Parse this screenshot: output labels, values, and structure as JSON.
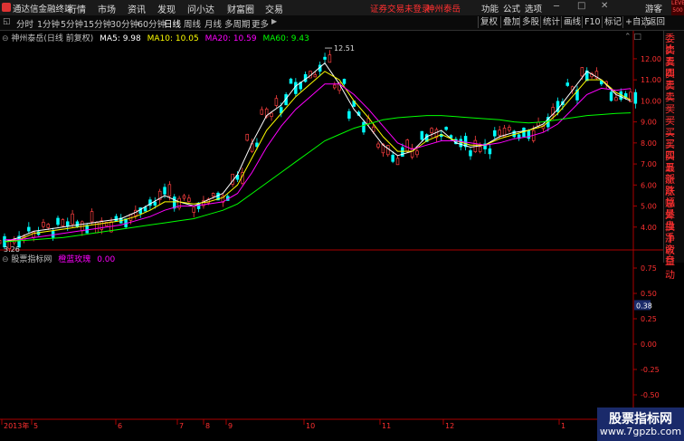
{
  "top": {
    "app_title": "通达信金融终端",
    "menu": [
      "行情",
      "市场",
      "资讯",
      "发现",
      "问小达",
      "财富圈",
      "交易"
    ],
    "login_notice": "证券交易未登录",
    "stock_name": "神州泰岳",
    "right_menu": [
      "功能",
      "公式",
      "选项"
    ],
    "guest": "游客",
    "level_badge": "LEVEL 500"
  },
  "toolbar": {
    "periods": [
      "分时",
      "1分钟",
      "5分钟",
      "15分钟",
      "30分钟",
      "60分钟",
      "日线",
      "周线",
      "月线",
      "多周期",
      "更多"
    ],
    "active_period": "日线",
    "buttons": [
      "复权",
      "叠加",
      "多股",
      "统计",
      "画线",
      "F10",
      "标记",
      "+自选",
      "返回"
    ]
  },
  "main_chart": {
    "title": "神州泰岳(日线 前复权)",
    "ma": [
      {
        "label": "MA5: 9.98",
        "color": "#ffffff"
      },
      {
        "label": "MA10: 10.05",
        "color": "#ffff00"
      },
      {
        "label": "MA20: 10.59",
        "color": "#ff00ff"
      },
      {
        "label": "MA60: 9.43",
        "color": "#00ff00"
      }
    ],
    "high_label": "12.51",
    "low_label": "3.26",
    "y_ticks": [
      "12.00",
      "11.00",
      "10.00",
      "9.00",
      "8.00",
      "7.00",
      "6.00",
      "5.00",
      "4.00"
    ]
  },
  "side_panel": {
    "items": [
      "委比",
      "卖五",
      "卖四",
      "卖三",
      "卖二",
      "卖一",
      "买一",
      "买二",
      "买三",
      "买四",
      "买五",
      "最新",
      "涨跌",
      "涨幅",
      "总量",
      "外盘",
      "换手",
      "净资",
      "收益"
    ],
    "auto": "自动"
  },
  "sub_chart": {
    "source": "股票指标网",
    "indicator": "橙蓝玫瑰",
    "value": "0.00",
    "y_ticks": [
      "0.75",
      "0.50",
      "0.25",
      "0.00",
      "-0.25",
      "-0.50",
      "-0.75"
    ],
    "marker": "0.38"
  },
  "x_axis": {
    "labels": [
      "2013年",
      "5",
      "6",
      "7",
      "8",
      "9",
      "10",
      "11",
      "12",
      "1",
      "2"
    ]
  },
  "watermark": {
    "line1": "股票指标网",
    "line2": "www.7gpzb.com"
  },
  "chart_data": {
    "type": "candlestick",
    "yscale": "price",
    "ylim": [
      3.0,
      12.9
    ],
    "series": [
      {
        "name": "MA5",
        "color": "#ffffff",
        "values": [
          3.3,
          3.5,
          3.8,
          3.9,
          4.0,
          4.1,
          4.2,
          4.3,
          4.4,
          4.7,
          5.1,
          5.5,
          5.2,
          5.0,
          5.3,
          5.6,
          6.5,
          8.0,
          9.3,
          9.8,
          10.7,
          11.2,
          11.8,
          10.8,
          9.6,
          8.8,
          7.9,
          7.4,
          7.6,
          8.3,
          8.6,
          8.0,
          7.8,
          7.9,
          8.3,
          8.5,
          8.6,
          8.9,
          9.6,
          10.5,
          11.4,
          11.0,
          10.3,
          10.0
        ]
      },
      {
        "name": "MA10",
        "color": "#ffff00",
        "values": [
          3.3,
          3.4,
          3.7,
          3.8,
          3.9,
          4.0,
          4.1,
          4.2,
          4.3,
          4.5,
          4.8,
          5.2,
          5.2,
          5.1,
          5.2,
          5.4,
          6.0,
          7.3,
          8.6,
          9.4,
          10.2,
          10.8,
          11.4,
          11.0,
          10.0,
          9.2,
          8.3,
          7.6,
          7.6,
          8.1,
          8.4,
          8.1,
          7.9,
          7.9,
          8.2,
          8.4,
          8.6,
          8.8,
          9.4,
          10.2,
          11.0,
          11.0,
          10.4,
          10.05
        ]
      },
      {
        "name": "MA20",
        "color": "#ff00ff",
        "values": [
          3.4,
          3.4,
          3.5,
          3.6,
          3.7,
          3.8,
          3.9,
          4.0,
          4.1,
          4.3,
          4.5,
          4.8,
          5.0,
          5.0,
          5.1,
          5.2,
          5.6,
          6.6,
          7.8,
          8.8,
          9.6,
          10.2,
          10.8,
          10.8,
          10.3,
          9.6,
          8.8,
          8.0,
          7.7,
          7.9,
          8.1,
          8.1,
          8.0,
          7.9,
          8.0,
          8.2,
          8.3,
          8.5,
          8.9,
          9.6,
          10.3,
          10.6,
          10.5,
          10.59
        ]
      },
      {
        "name": "MA60",
        "color": "#00ff00",
        "values": [
          3.3,
          3.35,
          3.4,
          3.45,
          3.5,
          3.6,
          3.7,
          3.8,
          3.9,
          4.0,
          4.1,
          4.2,
          4.3,
          4.4,
          4.6,
          4.8,
          5.1,
          5.6,
          6.1,
          6.6,
          7.1,
          7.6,
          8.1,
          8.4,
          8.7,
          8.9,
          9.1,
          9.2,
          9.25,
          9.3,
          9.3,
          9.25,
          9.2,
          9.15,
          9.1,
          9.0,
          8.95,
          9.0,
          9.1,
          9.2,
          9.3,
          9.35,
          9.4,
          9.43
        ]
      }
    ]
  }
}
